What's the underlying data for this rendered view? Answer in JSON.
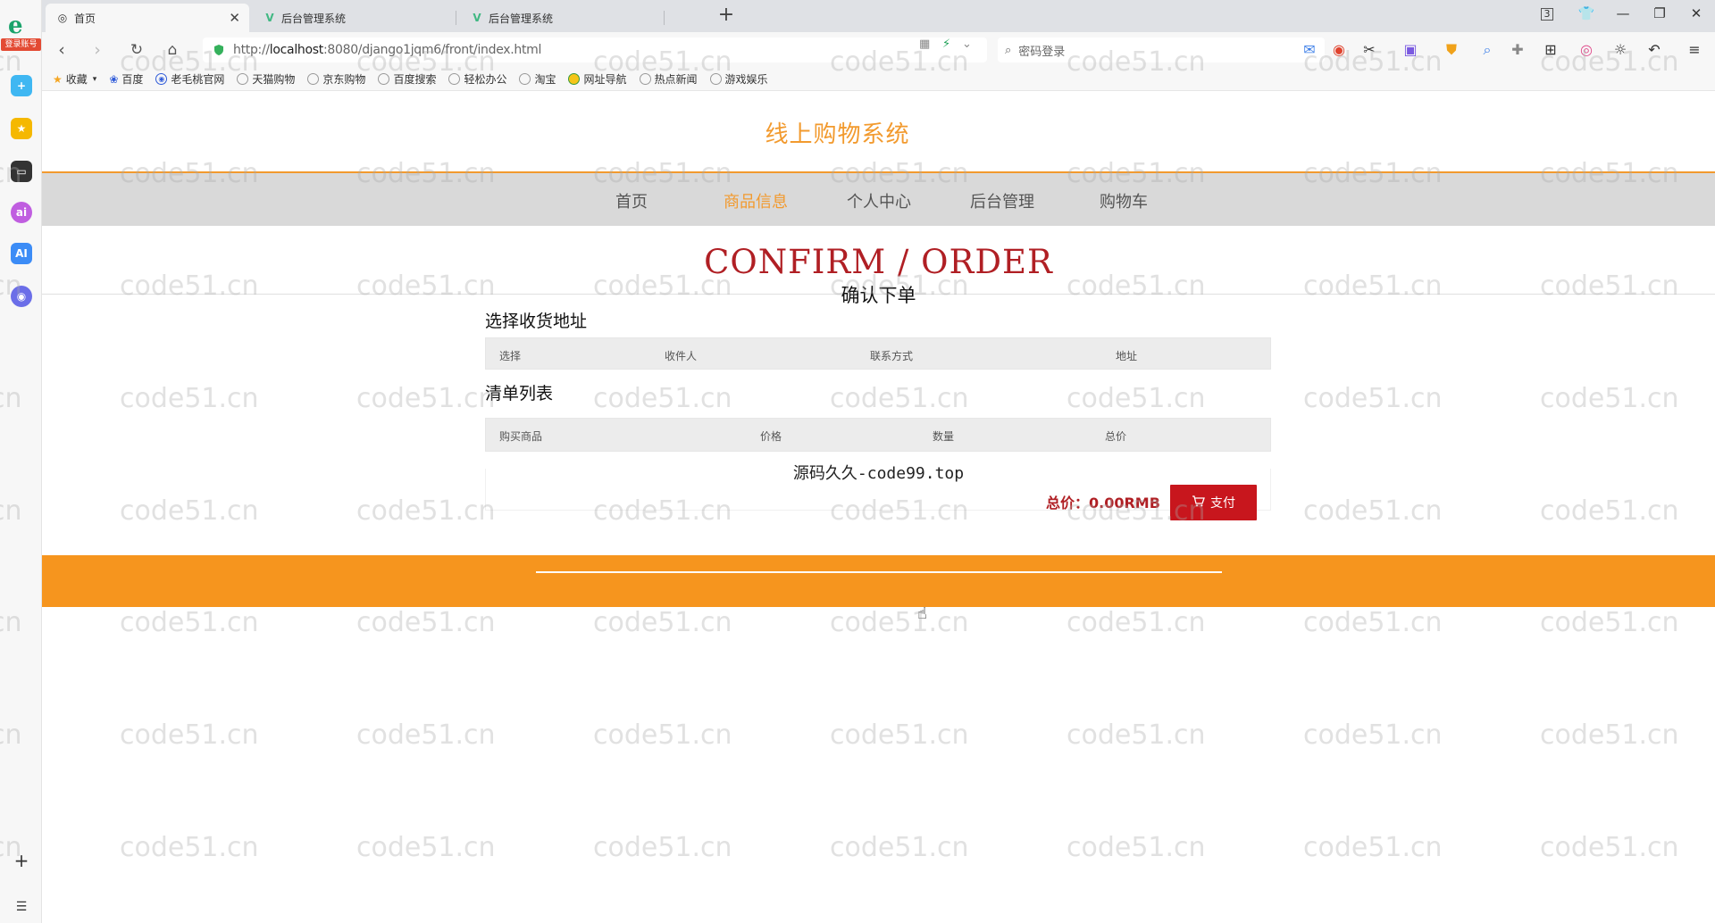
{
  "browser": {
    "tabs": [
      {
        "label": "首页",
        "active": true
      },
      {
        "label": "后台管理系统",
        "active": false
      },
      {
        "label": "后台管理系统",
        "active": false
      }
    ],
    "new_tab_label": "+",
    "url_prefix": "http://",
    "url_host": "localhost",
    "url_rest": ":8080/django1jqm6/front/index.html",
    "search_placeholder": "密码登录",
    "tab_count": "3",
    "bookmarks": [
      {
        "label": "收藏",
        "icon": "star-icon"
      },
      {
        "label": "百度",
        "icon": "baidu-icon"
      },
      {
        "label": "老毛桃官网",
        "icon": "globe-icon"
      },
      {
        "label": "天猫购物",
        "icon": "globe-icon"
      },
      {
        "label": "京东购物",
        "icon": "globe-icon"
      },
      {
        "label": "百度搜索",
        "icon": "globe-icon"
      },
      {
        "label": "轻松办公",
        "icon": "globe-icon"
      },
      {
        "label": "淘宝",
        "icon": "globe-icon"
      },
      {
        "label": "网址导航",
        "icon": "nav-icon"
      },
      {
        "label": "热点新闻",
        "icon": "globe-icon"
      },
      {
        "label": "游戏娱乐",
        "icon": "globe-icon"
      }
    ],
    "login_badge": "登录账号"
  },
  "site": {
    "title": "线上购物系统",
    "nav": [
      {
        "label": "首页",
        "active": false
      },
      {
        "label": "商品信息",
        "active": true
      },
      {
        "label": "个人中心",
        "active": false
      },
      {
        "label": "后台管理",
        "active": false
      },
      {
        "label": "购物车",
        "active": false
      }
    ]
  },
  "order": {
    "heading_en": "CONFIRM / ORDER",
    "heading_cn": "确认下单",
    "address_title": "选择收货地址",
    "address_columns": [
      "选择",
      "收件人",
      "联系方式",
      "地址"
    ],
    "list_title": "清单列表",
    "list_columns": [
      "购买商品",
      "价格",
      "数量",
      "总价"
    ],
    "total_label": "总价：0.00RMB",
    "pay_label": "支付"
  },
  "footnote": "源码久久-code99.top",
  "watermark": "code51.cn",
  "colors": {
    "accent": "#f29a2e",
    "footer": "#f6951e",
    "brand_red": "#b01f24",
    "pay_button": "#c8161d",
    "nav_bg": "#d9d9d9"
  }
}
